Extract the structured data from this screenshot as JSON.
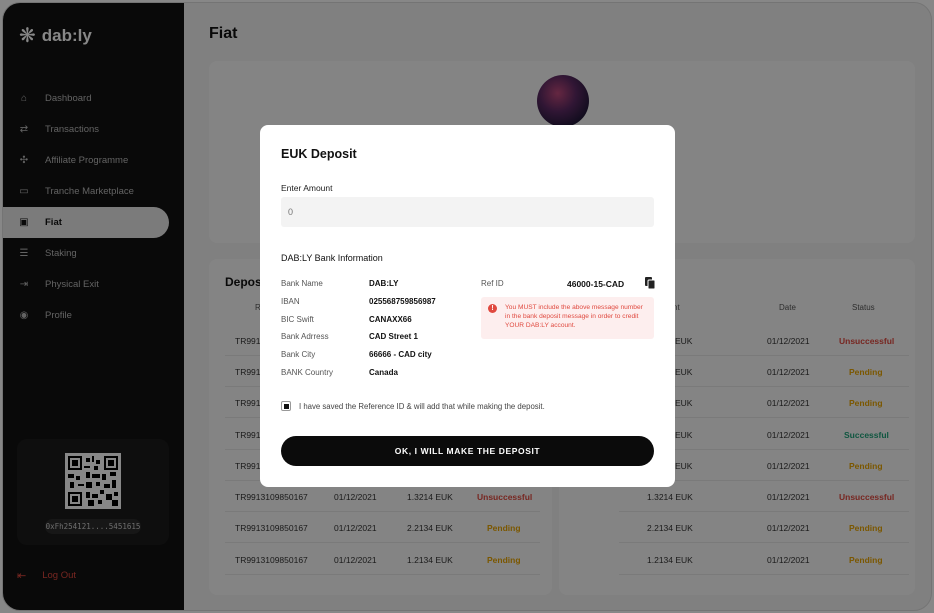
{
  "app": {
    "logo": "dab:ly"
  },
  "sidebar": {
    "items": [
      {
        "label": "Dashboard"
      },
      {
        "label": "Transactions"
      },
      {
        "label": "Affiliate Programme"
      },
      {
        "label": "Tranche Marketplace"
      },
      {
        "label": "Fiat"
      },
      {
        "label": "Staking"
      },
      {
        "label": "Physical Exit"
      },
      {
        "label": "Profile"
      }
    ],
    "wallet_address": "0xFh254121....5451615",
    "logout": "Log Out"
  },
  "page": {
    "title": "Fiat"
  },
  "deposits": {
    "title": "Depos",
    "col_ref": "Re",
    "rows": [
      {
        "ref": "TR9913",
        "date": "",
        "amount": "",
        "status": ""
      },
      {
        "ref": "TR9913",
        "date": "",
        "amount": "",
        "status": ""
      },
      {
        "ref": "TR9913",
        "date": "",
        "amount": "",
        "status": ""
      },
      {
        "ref": "TR9913",
        "date": "",
        "amount": "",
        "status": ""
      },
      {
        "ref": "TR9913",
        "date": "",
        "amount": "",
        "status": ""
      },
      {
        "ref": "TR9913109850167",
        "date": "01/12/2021",
        "amount": "1.3214 EUK",
        "status": "Unsuccessful"
      },
      {
        "ref": "TR9913109850167",
        "date": "01/12/2021",
        "amount": "2.2134 EUK",
        "status": "Pending"
      },
      {
        "ref": "TR9913109850167",
        "date": "01/12/2021",
        "amount": "1.2134 EUK",
        "status": "Pending"
      }
    ]
  },
  "withdrawals": {
    "col_amount": "nt",
    "col_date": "Date",
    "col_status": "Status",
    "rows": [
      {
        "amount": "EUK",
        "date": "01/12/2021",
        "status": "Unsuccessful"
      },
      {
        "amount": "EUK",
        "date": "01/12/2021",
        "status": "Pending"
      },
      {
        "amount": "EUK",
        "date": "01/12/2021",
        "status": "Pending"
      },
      {
        "amount": "EUK",
        "date": "01/12/2021",
        "status": "Successful"
      },
      {
        "amount": "EUK",
        "date": "01/12/2021",
        "status": "Pending"
      },
      {
        "amount": "1.3214 EUK",
        "date": "01/12/2021",
        "status": "Unsuccessful"
      },
      {
        "amount": "2.2134 EUK",
        "date": "01/12/2021",
        "status": "Pending"
      },
      {
        "amount": "1.2134 EUK",
        "date": "01/12/2021",
        "status": "Pending"
      }
    ]
  },
  "modal": {
    "title": "EUK Deposit",
    "amount_label": "Enter Amount",
    "amount_placeholder": "0",
    "bank_heading": "DAB:LY Bank Information",
    "bank_fields": [
      {
        "key": "Bank Name",
        "value": "DAB:LY"
      },
      {
        "key": "IBAN",
        "value": "025568759856987"
      },
      {
        "key": "BIC Swift",
        "value": "CANAXX66"
      },
      {
        "key": "Bank Adrress",
        "value": "CAD Street 1"
      },
      {
        "key": "Bank City",
        "value": "66666 - CAD city"
      },
      {
        "key": "BANK Country",
        "value": "Canada"
      }
    ],
    "ref_label": "Ref ID",
    "ref_value": "46000-15-CAD",
    "warning": "You MUST include the above message number in the bank deposit message in order to credit YOUR DAB:LY account.",
    "checkbox_label": "I have saved the Reference ID & will add that while making the deposit.",
    "confirm_button": "OK, I WILL MAKE THE DEPOSIT"
  },
  "colors": {
    "error": "#e0493f",
    "pending": "#e9a400",
    "success": "#1fa37a",
    "sidebar": "#111111"
  }
}
